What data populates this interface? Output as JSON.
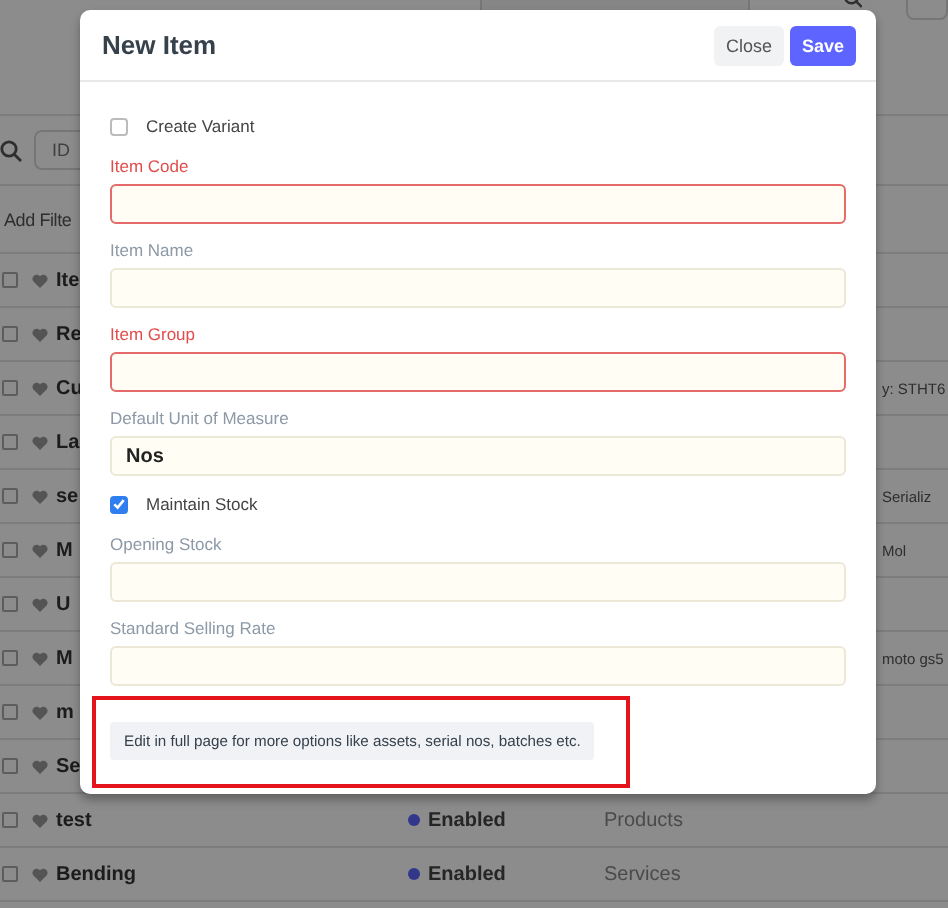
{
  "list_view": {
    "id_filter": {
      "placeholder": "ID"
    },
    "add_filter": "Add Filte",
    "rows": [
      {
        "name": "Ite",
        "checked": false
      },
      {
        "name": "Re",
        "checked": false
      },
      {
        "name": "Cu",
        "column_5": "y: STHT6",
        "checked": false
      },
      {
        "name": "La",
        "checked": false
      },
      {
        "name": "se",
        "column_5": "Serializ",
        "checked": false
      },
      {
        "name": "M",
        "column_5": "Mol",
        "checked": false
      },
      {
        "name": "U",
        "checked": false
      },
      {
        "name": "M",
        "column_5": "moto gs5",
        "checked": false
      },
      {
        "name": "m",
        "checked": false
      },
      {
        "name": "Se",
        "checked": false
      },
      {
        "name": "test",
        "status": "Enabled",
        "category": "Products",
        "checked": false
      },
      {
        "name": "Bending",
        "status": "Enabled",
        "category": "Services",
        "checked": false
      }
    ]
  },
  "dialog": {
    "title": "New Item",
    "buttons": [
      {
        "label": "Close",
        "kind": "secondary"
      },
      {
        "label": "Save",
        "kind": "primary"
      }
    ],
    "fields": [
      {
        "kind": "checkbox",
        "label": "Create Variant",
        "checked": false
      },
      {
        "kind": "input",
        "label": "Item Code",
        "required": true
      },
      {
        "kind": "input",
        "label": "Item Name",
        "required": false
      },
      {
        "kind": "input",
        "label": "Item Group",
        "required": true
      },
      {
        "kind": "input",
        "label": "Default Unit of Measure",
        "required": false,
        "value": "Nos"
      },
      {
        "kind": "checkbox",
        "label": "Maintain Stock",
        "checked": true
      },
      {
        "kind": "input",
        "label": "Opening Stock",
        "required": false
      },
      {
        "kind": "input",
        "label": "Standard Selling Rate",
        "required": false
      }
    ],
    "note": "Edit in full page for more options like assets, serial nos, batches etc."
  }
}
